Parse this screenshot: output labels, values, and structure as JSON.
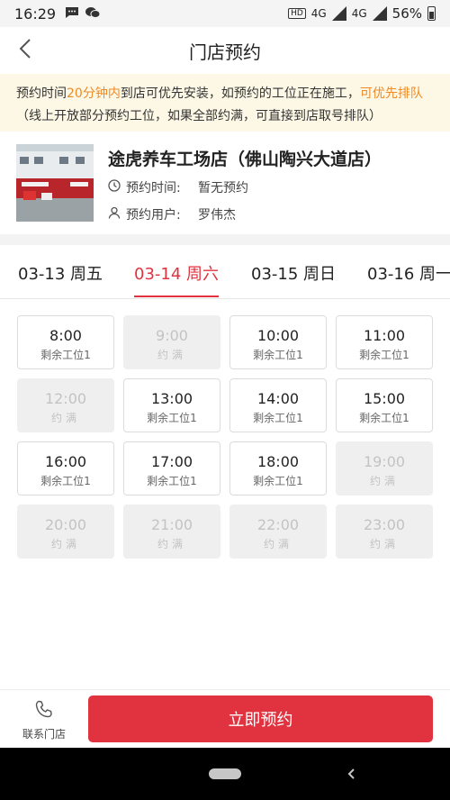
{
  "status_bar": {
    "time": "16:29",
    "hd": "HD",
    "net1": "4G",
    "net2": "4G",
    "battery": "56%"
  },
  "header": {
    "title": "门店预约"
  },
  "notice": {
    "p1": "预约时间",
    "h1": "20分钟内",
    "p2": "到店可优先安装，如预约的工位正在施工，",
    "h2": "可优先排队",
    "p3": "（线上开放部分预约工位，如果全部约满，可直接到店取号排队）"
  },
  "store": {
    "name": "途虎养车工场店（佛山陶兴大道店）",
    "time_label": "预约时间:",
    "time_value": "暂无预约",
    "user_label": "预约用户:",
    "user_value": "罗伟杰"
  },
  "tabs": [
    {
      "label": "03-13 周五",
      "active": false
    },
    {
      "label": "03-14 周六",
      "active": true
    },
    {
      "label": "03-15 周日",
      "active": false
    },
    {
      "label": "03-16 周一",
      "active": false
    }
  ],
  "slots": [
    {
      "time": "8:00",
      "status": "剩余工位1",
      "full": false
    },
    {
      "time": "9:00",
      "status": "约满",
      "full": true
    },
    {
      "time": "10:00",
      "status": "剩余工位1",
      "full": false
    },
    {
      "time": "11:00",
      "status": "剩余工位1",
      "full": false
    },
    {
      "time": "12:00",
      "status": "约满",
      "full": true
    },
    {
      "time": "13:00",
      "status": "剩余工位1",
      "full": false
    },
    {
      "time": "14:00",
      "status": "剩余工位1",
      "full": false
    },
    {
      "time": "15:00",
      "status": "剩余工位1",
      "full": false
    },
    {
      "time": "16:00",
      "status": "剩余工位1",
      "full": false
    },
    {
      "time": "17:00",
      "status": "剩余工位1",
      "full": false
    },
    {
      "time": "18:00",
      "status": "剩余工位1",
      "full": false
    },
    {
      "time": "19:00",
      "status": "约满",
      "full": true
    },
    {
      "time": "20:00",
      "status": "约满",
      "full": true
    },
    {
      "time": "21:00",
      "status": "约满",
      "full": true
    },
    {
      "time": "22:00",
      "status": "约满",
      "full": true
    },
    {
      "time": "23:00",
      "status": "约满",
      "full": true
    }
  ],
  "bottom": {
    "contact_label": "联系门店",
    "book_label": "立即预约"
  },
  "colors": {
    "accent": "#e0333f",
    "highlight": "#f08a24",
    "notice_bg": "#fdf8e6"
  }
}
